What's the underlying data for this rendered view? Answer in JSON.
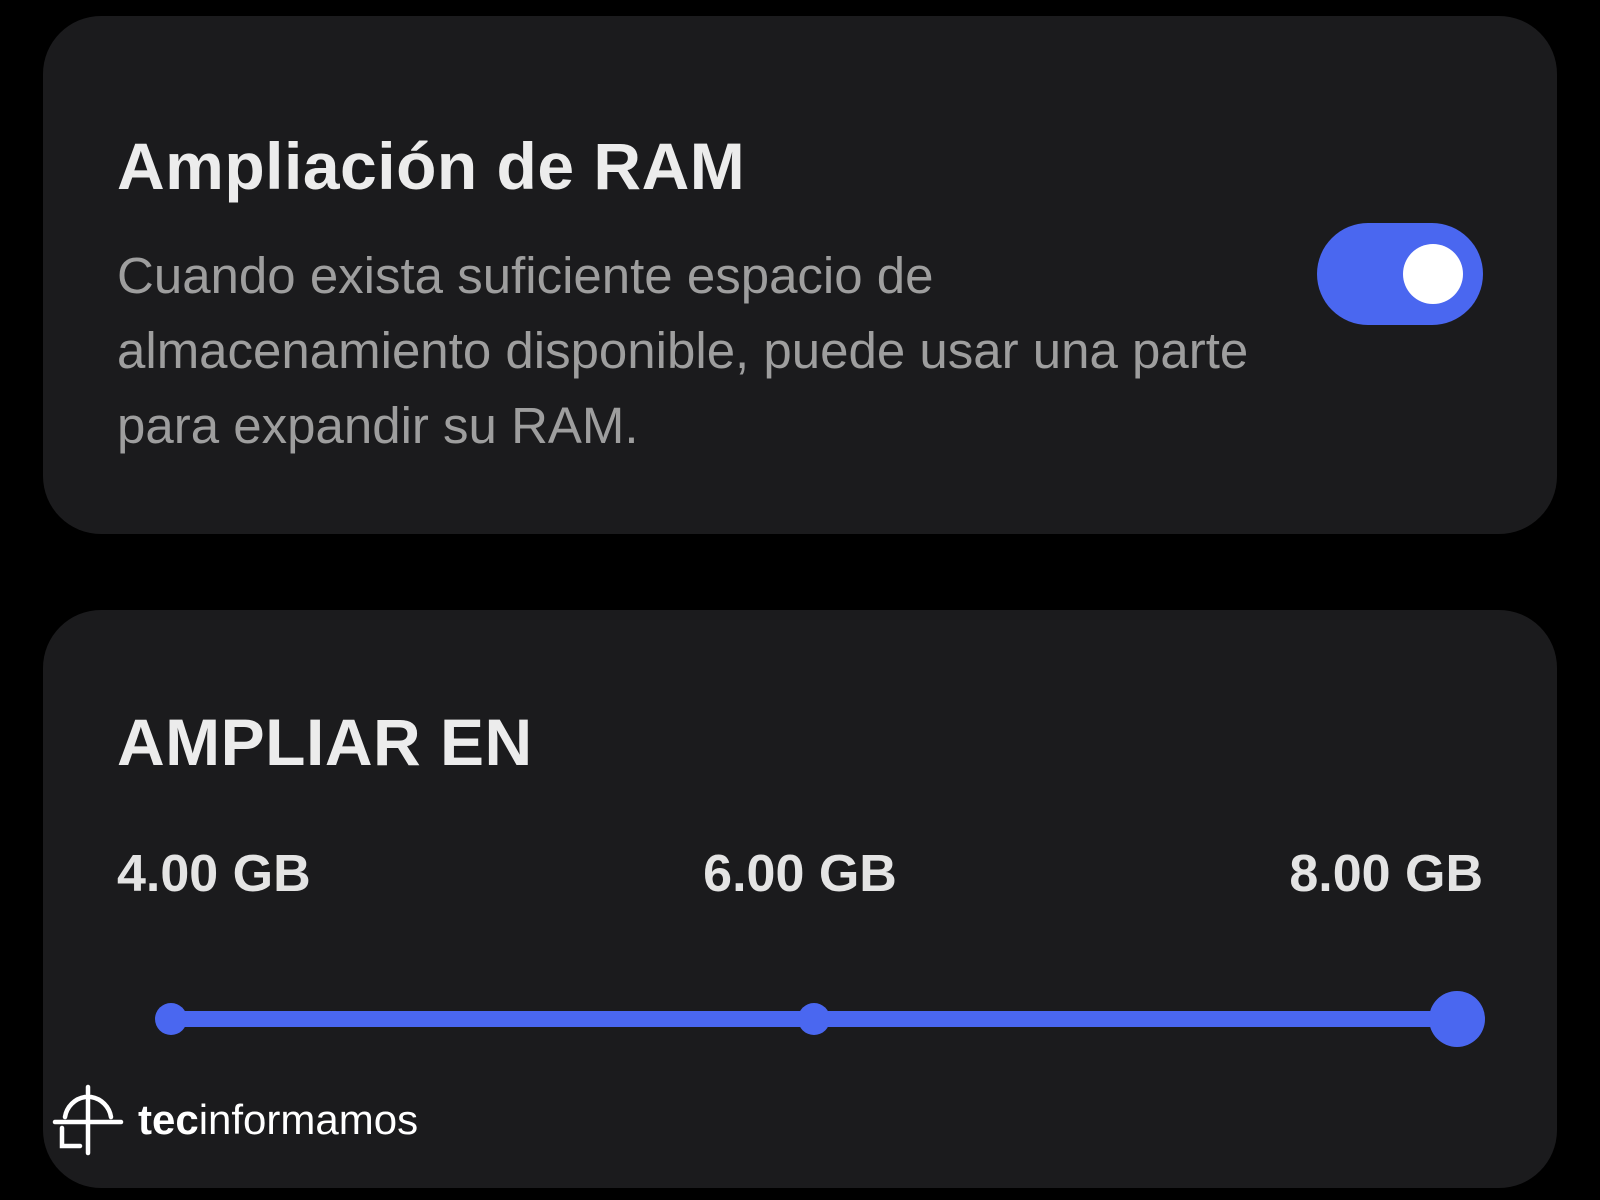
{
  "ram_plus": {
    "title": "Ampliación de RAM",
    "description": "Cuando exista suficiente espacio de almacenamiento disponible, puede usar una parte para expandir su RAM.",
    "toggle_on": true
  },
  "expand_by": {
    "title": "AMPLIAR EN",
    "options": [
      "4.00 GB",
      "6.00 GB",
      "8.00 GB"
    ],
    "selected_index": 2,
    "selected_value": "8.00 GB"
  },
  "watermark": {
    "brand_bold": "tec",
    "brand_rest": "informamos",
    "icon": "crosshair-logo-icon"
  },
  "colors": {
    "accent": "#4a67f0",
    "card_background": "#1b1b1d",
    "screen_background": "#000000",
    "title_text": "#ececec",
    "secondary_text": "#9e9e9e"
  }
}
